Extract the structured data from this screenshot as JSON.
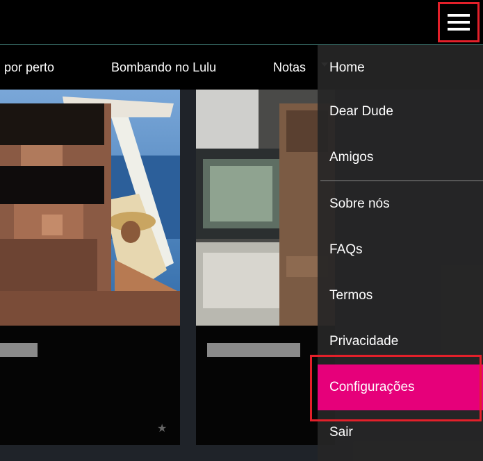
{
  "header": {
    "menu_icon": "hamburger-icon",
    "accent_color": "#4a8f88"
  },
  "tabs": [
    {
      "label": "i por perto"
    },
    {
      "label": "Bombando no Lulu"
    },
    {
      "label": "Notas"
    }
  ],
  "cards": [
    {
      "star": "★"
    },
    {
      "star": "★"
    }
  ],
  "menu": {
    "items": [
      {
        "label": "Home"
      },
      {
        "label": "Dear Dude"
      },
      {
        "label": "Amigos"
      },
      {
        "label": "Sobre nós"
      },
      {
        "label": "FAQs"
      },
      {
        "label": "Termos"
      },
      {
        "label": "Privacidade"
      },
      {
        "label": "Configurações"
      },
      {
        "label": "Sair"
      }
    ],
    "active_item": "Configurações",
    "active_color": "#e6007a",
    "highlight_color": "#e3202a"
  }
}
